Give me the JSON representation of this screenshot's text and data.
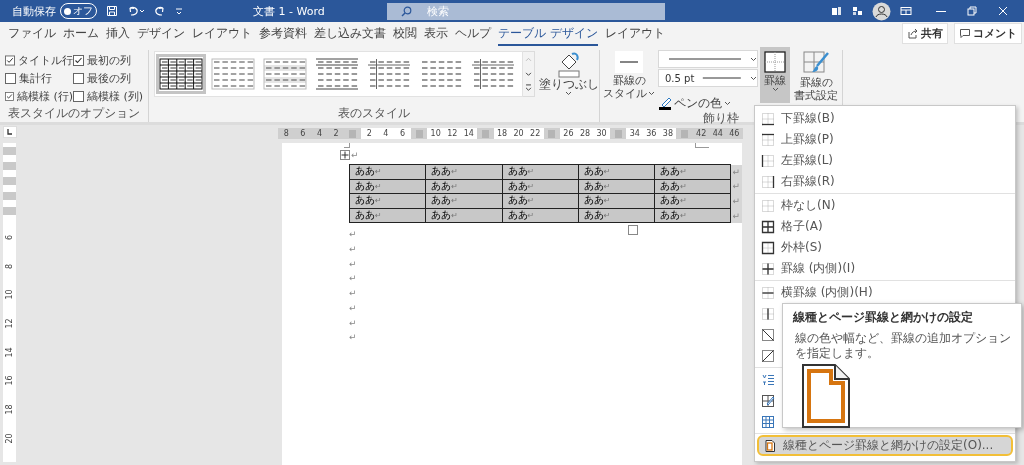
{
  "title_bar": {
    "autosave_label": "自動保存",
    "autosave": {
      "on": false,
      "label": "オフ"
    },
    "title": "文書 1 - Word",
    "search": {
      "placeholder": "検索"
    }
  },
  "tabs": [
    {
      "label": "ファイル",
      "selected": false
    },
    {
      "label": "ホーム",
      "selected": false
    },
    {
      "label": "挿入",
      "selected": false
    },
    {
      "label": "デザイン",
      "selected": false
    },
    {
      "label": "レイアウト",
      "selected": false
    },
    {
      "label": "参考資料",
      "selected": false
    },
    {
      "label": "差し込み文書",
      "selected": false
    },
    {
      "label": "校閲",
      "selected": false
    },
    {
      "label": "表示",
      "selected": false
    },
    {
      "label": "ヘルプ",
      "selected": false
    },
    {
      "label": "テーブル デザイン",
      "selected": true
    },
    {
      "label": "レイアウト",
      "selected": false
    }
  ],
  "tab_buttons": [
    {
      "kind": "share",
      "label": "共有"
    },
    {
      "kind": "comment",
      "label": "コメント"
    }
  ],
  "ribbon": {
    "style_options": {
      "title": "表スタイルのオプション",
      "options": [
        {
          "label": "タイトル行",
          "checked": true
        },
        {
          "label": "最初の列",
          "checked": true
        },
        {
          "label": "集計行",
          "checked": false
        },
        {
          "label": "最後の列",
          "checked": false
        },
        {
          "label": "縞模様 (行)",
          "checked": true
        },
        {
          "label": "縞模様 (列)",
          "checked": false
        }
      ]
    },
    "table_styles": {
      "title": "表のスタイル",
      "styles": [
        {
          "kind": "grid",
          "selected": true
        },
        {
          "kind": "plain",
          "selected": false
        },
        {
          "kind": "shaded",
          "selected": false
        },
        {
          "kind": "lines",
          "selected": false
        },
        {
          "kind": "first-col",
          "selected": false
        },
        {
          "kind": "dashes",
          "selected": false
        },
        {
          "kind": "first-col",
          "selected": false
        }
      ],
      "shading": {
        "label": "塗りつぶし"
      }
    },
    "borders": {
      "title": "飾り枠",
      "border_styles": {
        "label_lines": [
          "罫線の",
          "スタイル"
        ]
      },
      "line_weight": {
        "value": "0.5 pt"
      },
      "pen_color": {
        "label": "ペンの色"
      },
      "borders_button": {
        "label": "罫線",
        "expanded": true
      },
      "border_painter": {
        "label_lines": [
          "罫線の",
          "書式設定"
        ]
      }
    }
  },
  "ruler": {
    "segments": [
      {
        "margin": true,
        "labels": [
          "8",
          "6",
          "4",
          "2"
        ]
      },
      {
        "margin": false,
        "labels": [
          "2",
          "4",
          "6"
        ]
      },
      {
        "margin": false,
        "labels": [
          "10",
          "12",
          "14"
        ]
      },
      {
        "margin": false,
        "labels": [
          "18",
          "20",
          "22"
        ]
      },
      {
        "margin": false,
        "labels": [
          "26",
          "28",
          "30"
        ]
      },
      {
        "margin": false,
        "labels": [
          "34",
          "36",
          "38"
        ]
      },
      {
        "margin": true,
        "labels": [
          "42",
          "44",
          "46"
        ]
      }
    ]
  },
  "vertical_ruler": {
    "labels": [
      "6",
      "8",
      "10",
      "12",
      "14",
      "16",
      "18",
      "20"
    ]
  },
  "document": {
    "first_mark": "↵",
    "table": {
      "rows": [
        {
          "cells": [
            {
              "text": "ああ",
              "mark": "↵"
            },
            {
              "text": "ああ",
              "mark": "↵"
            },
            {
              "text": "ああ",
              "mark": "↵"
            },
            {
              "text": "ああ",
              "mark": "↵"
            },
            {
              "text": "ああ",
              "mark": "↵"
            }
          ],
          "end_mark": "↵"
        },
        {
          "cells": [
            {
              "text": "ああ",
              "mark": "↵"
            },
            {
              "text": "ああ",
              "mark": "↵"
            },
            {
              "text": "ああ",
              "mark": "↵"
            },
            {
              "text": "ああ",
              "mark": "↵"
            },
            {
              "text": "ああ",
              "mark": "↵"
            }
          ],
          "end_mark": "↵"
        },
        {
          "cells": [
            {
              "text": "ああ",
              "mark": "↵"
            },
            {
              "text": "ああ",
              "mark": "↵"
            },
            {
              "text": "ああ",
              "mark": "↵"
            },
            {
              "text": "ああ",
              "mark": "↵"
            },
            {
              "text": "ああ",
              "mark": "↵"
            }
          ],
          "end_mark": "↵"
        },
        {
          "cells": [
            {
              "text": "ああ",
              "mark": "↵"
            },
            {
              "text": "ああ",
              "mark": "↵"
            },
            {
              "text": "ああ",
              "mark": "↵"
            },
            {
              "text": "ああ",
              "mark": "↵"
            },
            {
              "text": "ああ",
              "mark": "↵"
            }
          ],
          "end_mark": "↵"
        }
      ]
    },
    "paragraph_marks": [
      "↵",
      "↵",
      "↵",
      "↵",
      "↵",
      "↵",
      "↵",
      "↵"
    ]
  },
  "borders_menu": {
    "sections": [
      [
        {
          "kind": "bottom",
          "label": "下罫線(B)",
          "selected": false
        },
        {
          "kind": "top",
          "label": "上罫線(P)",
          "selected": false
        },
        {
          "kind": "left",
          "label": "左罫線(L)",
          "selected": false
        },
        {
          "kind": "right",
          "label": "右罫線(R)",
          "selected": false
        }
      ],
      [
        {
          "kind": "none",
          "label": "枠なし(N)",
          "selected": false
        },
        {
          "kind": "all",
          "label": "格子(A)",
          "selected": false
        },
        {
          "kind": "outside",
          "label": "外枠(S)",
          "selected": false
        },
        {
          "kind": "inside",
          "label": "罫線 (内側)(I)",
          "selected": false
        }
      ],
      [
        {
          "kind": "inside-h",
          "label": "横罫線 (内側)(H)",
          "selected": false
        },
        {
          "kind": "inside-v",
          "selected": false
        },
        {
          "kind": "diag-down",
          "selected": false
        },
        {
          "kind": "diag-up",
          "selected": false
        }
      ],
      [
        {
          "kind": "text",
          "selected": false
        },
        {
          "kind": "draw",
          "selected": false
        },
        {
          "kind": "grid",
          "selected": false
        }
      ],
      [
        {
          "kind": "dialog",
          "label": "線種とページ罫線と網かけの設定(O)...",
          "selected": true
        }
      ]
    ]
  },
  "tooltip": {
    "title": "線種とページ罫線と網かけの設定",
    "description": "線の色や幅など、罫線の追加オプションを指定します。"
  }
}
